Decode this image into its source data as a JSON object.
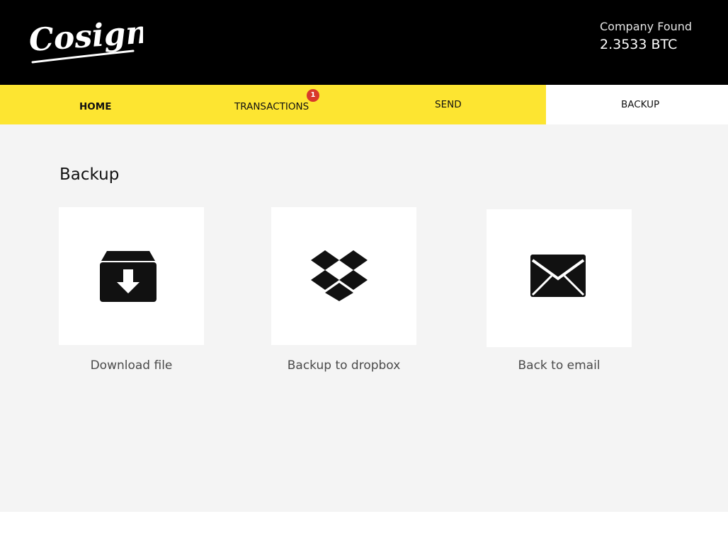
{
  "app": {
    "logo_text": "Cosign"
  },
  "account": {
    "name": "Company Found",
    "balance": "2.3533 BTC"
  },
  "nav": {
    "tabs": [
      {
        "label": "HOME",
        "active": false
      },
      {
        "label": "TRANSACTIONS",
        "badge": "1"
      },
      {
        "label": "SEND"
      },
      {
        "label": "BACKUP",
        "selected": true
      }
    ]
  },
  "colors": {
    "header_bg": "#000000",
    "nav_bg": "#fde531",
    "badge_bg": "#d8392b",
    "content_bg": "#f4f4f4",
    "card_bg": "#ffffff"
  },
  "main": {
    "title": "Backup",
    "options": [
      {
        "label": "Download file",
        "icon": "archive-download-icon"
      },
      {
        "label": "Backup to dropbox",
        "icon": "dropbox-icon"
      },
      {
        "label": "Back to email",
        "icon": "envelope-icon"
      }
    ]
  }
}
